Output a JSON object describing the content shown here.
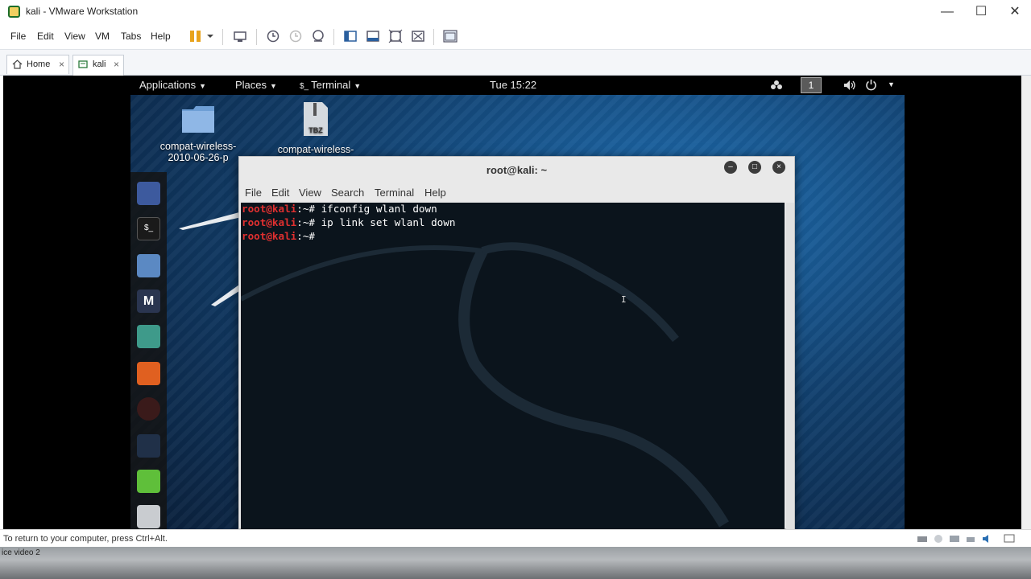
{
  "window": {
    "title": "kali - VMware Workstation",
    "minimize_glyph": "—",
    "maximize_glyph": "☐",
    "close_glyph": "✕"
  },
  "menubar": {
    "items": [
      "File",
      "Edit",
      "View",
      "VM",
      "Tabs",
      "Help"
    ]
  },
  "tabs": [
    {
      "label": "Home",
      "icon": "home-icon"
    },
    {
      "label": "kali",
      "icon": "vm-icon"
    }
  ],
  "gnome": {
    "applications": "Applications",
    "places": "Places",
    "terminal": "Terminal",
    "clock": "Tue 15:22",
    "workspace": "1"
  },
  "desktop_icons": [
    {
      "label_line1": "compat-wireless-",
      "label_line2": "2010-06-26-p",
      "icon": "folder-icon"
    },
    {
      "label_line1": "compat-wireless-",
      "label_line2": "",
      "icon": "archive-icon",
      "badge": "TBZ"
    }
  ],
  "terminal": {
    "title": "root@kali: ~",
    "menu": [
      "File",
      "Edit",
      "View",
      "Search",
      "Terminal",
      "Help"
    ],
    "lines": [
      {
        "user": "root@kali",
        "path": ":~# ",
        "cmd": "ifconfig wlanl down"
      },
      {
        "user": "root@kali",
        "path": ":~# ",
        "cmd": "ip link set wlanl down"
      },
      {
        "user": "root@kali",
        "path": ":~# ",
        "cmd": ""
      }
    ]
  },
  "statusbar": {
    "hint": "To return to your computer, press Ctrl+Alt."
  },
  "overlay_caption": "ice video 2",
  "colors": {
    "prompt_user": "#e03030",
    "terminal_bg": "#0b141c",
    "vmware_accent": "#e8a31c"
  }
}
